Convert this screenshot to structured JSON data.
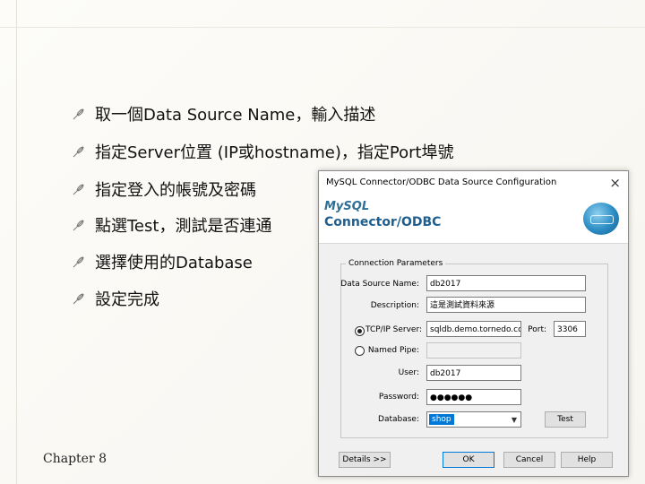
{
  "bullets": [
    "取一個Data Source Name，輸入描述",
    "指定Server位置 (IP或hostname)，指定Port埠號",
    "指定登入的帳號及密碼",
    "點選Test，測試是否連通",
    "選擇使用的Database",
    "設定完成"
  ],
  "footer": "Chapter 8",
  "dialog": {
    "title": "MySQL Connector/ODBC Data Source Configuration",
    "close": "×",
    "logo_top": "MySQL",
    "logo_bottom": "Connector/ODBC",
    "group_label": "Connection Parameters",
    "labels": {
      "dsn": "Data Source Name:",
      "desc": "Description:",
      "tcp": "TCP/IP Server:",
      "port": "Port:",
      "pipe": "Named Pipe:",
      "user": "User:",
      "password": "Password:",
      "database": "Database:"
    },
    "values": {
      "dsn": "db2017",
      "desc": "這是測試資料來源",
      "server": "sqldb.demo.tornedo.com",
      "port": "3306",
      "user": "db2017",
      "password": "●●●●●●",
      "database": "shop"
    },
    "buttons": {
      "test": "Test",
      "details": "Details >>",
      "ok": "OK",
      "cancel": "Cancel",
      "help": "Help"
    }
  },
  "colors": {
    "accent": "#0078d7",
    "brand": "#1f5f8f"
  }
}
